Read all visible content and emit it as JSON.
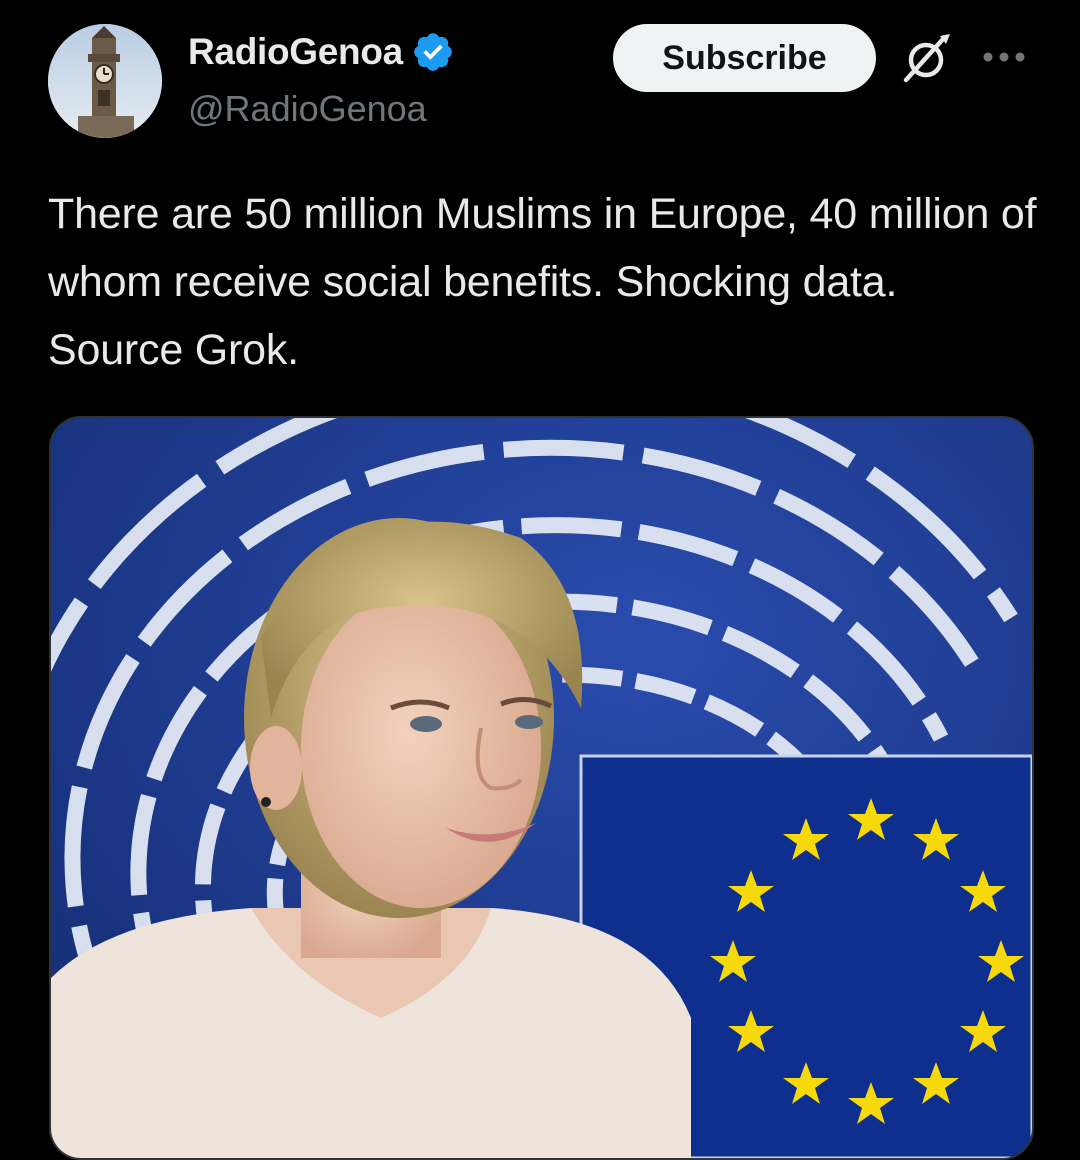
{
  "post": {
    "author": {
      "display_name": "RadioGenoa",
      "handle": "@RadioGenoa",
      "verified": true,
      "avatar_icon": "clock-tower-avatar"
    },
    "actions": {
      "subscribe_label": "Subscribe",
      "grok_icon": "grok-icon",
      "more_icon": "more-horizontal-icon"
    },
    "text": "There are 50 million Muslims in Europe, 40 million of whom receive social benefits. Shocking data. Source Grok.",
    "media": {
      "type": "photo"
    }
  },
  "colors": {
    "background": "#000000",
    "text_primary": "#e7e9ea",
    "text_secondary": "#71767b",
    "verified_blue": "#1d9bf0",
    "subscribe_bg": "#eff3f4",
    "photo_blue": "#1a3a8c",
    "star_yellow": "#f5d90a"
  }
}
